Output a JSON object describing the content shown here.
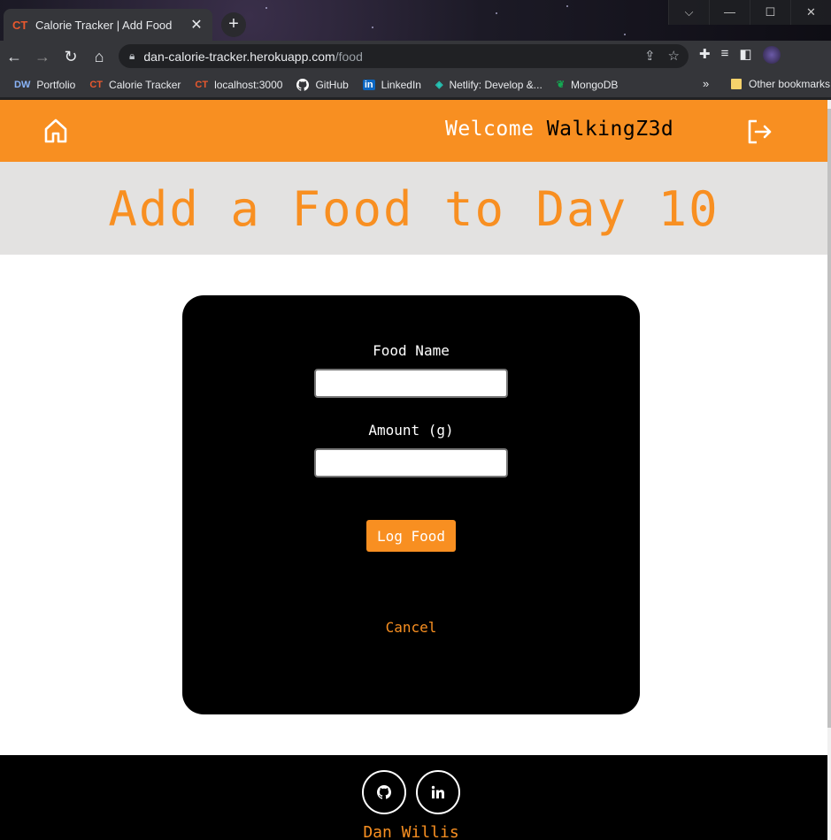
{
  "browser": {
    "tab": {
      "favicon": "CT",
      "title": "Calorie Tracker | Add Food"
    },
    "address": {
      "host": "dan-calorie-tracker.herokuapp.com",
      "path": "/food"
    },
    "bookmarks": [
      {
        "icon": "DW",
        "label": "Portfolio",
        "icon_color": "#8ab4f8"
      },
      {
        "icon": "CT",
        "label": "Calorie Tracker",
        "icon_color": "#e8582e"
      },
      {
        "icon": "CT",
        "label": "localhost:3000",
        "icon_color": "#e8582e"
      },
      {
        "icon": "github-icon",
        "label": "GitHub",
        "icon_color": "#ffffff"
      },
      {
        "icon": "in",
        "label": "LinkedIn",
        "icon_color": "#0a66c2"
      },
      {
        "icon": "netlify-icon",
        "label": "Netlify: Develop &...",
        "icon_color": "#25c7b7"
      },
      {
        "icon": "mongodb-icon",
        "label": "MongoDB",
        "icon_color": "#13aa52"
      }
    ],
    "bookmarks_more": "»",
    "other_bookmarks": "Other bookmarks"
  },
  "app": {
    "accent": "#f88f21",
    "navbar": {
      "welcome": "Welcome",
      "username": "WalkingZ3d"
    },
    "heading": "Add a Food to Day 10",
    "form": {
      "food_name_label": "Food Name",
      "food_name_value": "",
      "amount_label": "Amount (g)",
      "amount_value": "",
      "submit_label": "Log Food",
      "cancel_label": "Cancel"
    },
    "footer": {
      "author": "Dan Willis"
    }
  }
}
